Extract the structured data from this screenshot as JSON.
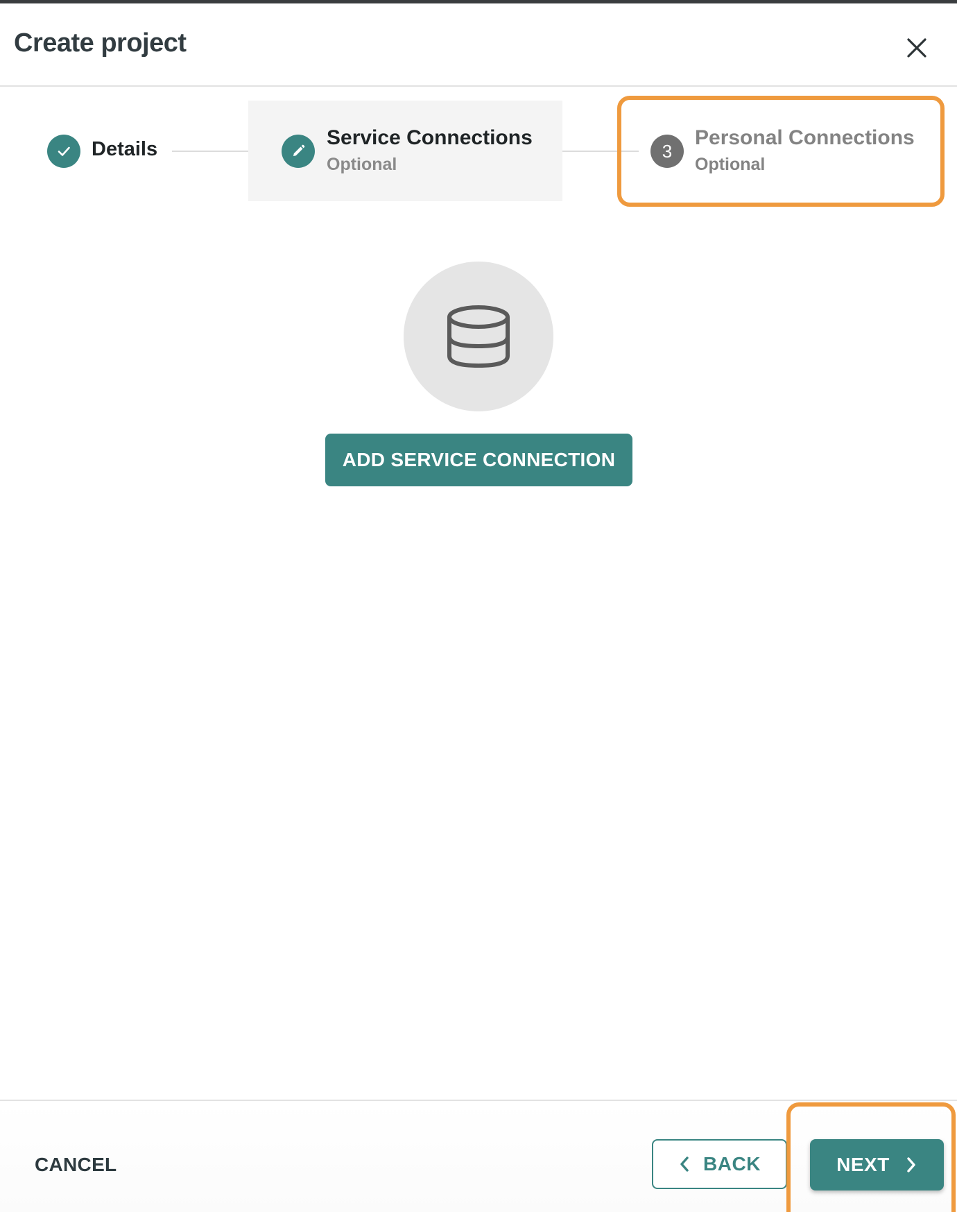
{
  "dialog": {
    "title": "Create project"
  },
  "stepper": {
    "steps": [
      {
        "label": "Details",
        "state": "completed",
        "icon": "check-icon"
      },
      {
        "label": "Service Connections",
        "sublabel": "Optional",
        "state": "active",
        "icon": "pencil-icon"
      },
      {
        "label": "Personal Connections",
        "sublabel": "Optional",
        "state": "pending",
        "number": "3"
      }
    ]
  },
  "empty_state": {
    "icon": "database-icon",
    "button_label": "ADD SERVICE CONNECTION"
  },
  "footer": {
    "cancel_label": "CANCEL",
    "back_label": "BACK",
    "next_label": "NEXT"
  },
  "colors": {
    "accent": "#3a8582",
    "highlight": "#ef9a3e",
    "pending_step": "#707070"
  }
}
